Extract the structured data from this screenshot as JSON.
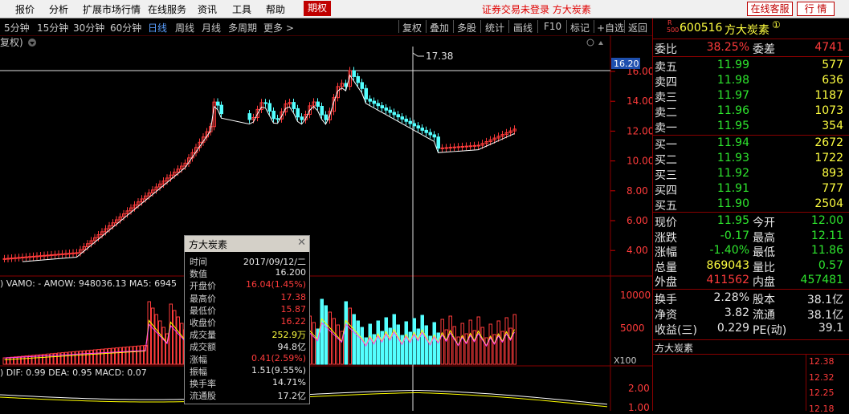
{
  "menu": {
    "items": [
      "报价",
      "分析",
      "扩展市场行情",
      "在线服务",
      "资讯",
      "工具",
      "帮助"
    ],
    "option_tab": "期权",
    "notice": "证券交易未登录  方大炭素",
    "online_service": "在线客服",
    "quote_button": "行 情"
  },
  "toolbar": {
    "periods": [
      "5分钟",
      "15分钟",
      "30分钟",
      "60分钟",
      "日线",
      "周线",
      "月线",
      "多周期",
      "更多 >"
    ],
    "active_period": "日线",
    "buttons": [
      "复权",
      "叠加",
      "多股",
      "统计",
      "画线",
      "F10",
      "标记",
      "+自选",
      "返回"
    ]
  },
  "chart": {
    "adjust_label": "复权)",
    "peak_label": "17.38",
    "current_price_tag": "16.20",
    "price_axis": [
      "16.00",
      "14.00",
      "12.00",
      "10.00",
      "8.00",
      "6.00",
      "4.00"
    ],
    "volume_header": ") VAMO: -   AMOW: 948036.13  MA5: 6945",
    "volume_axis": [
      "10000",
      "5000"
    ],
    "volume_unit": "X100",
    "macd_header": ") DIF: 0.99  DEA: 0.95  MACD: 0.07",
    "macd_axis": [
      "2.00",
      "1.00"
    ]
  },
  "tooltip": {
    "title": "方大炭素",
    "rows": [
      {
        "k": "时间",
        "v": "2017/09/12/二",
        "c": "white"
      },
      {
        "k": "数值",
        "v": "16.200",
        "c": "white"
      },
      {
        "k": "开盘价",
        "v": "16.04(1.45%)",
        "c": "red"
      },
      {
        "k": "最高价",
        "v": "17.38",
        "c": "red"
      },
      {
        "k": "最低价",
        "v": "15.87",
        "c": "red"
      },
      {
        "k": "收盘价",
        "v": "16.22",
        "c": "red"
      },
      {
        "k": "成交量",
        "v": "252.9万",
        "c": "yellow"
      },
      {
        "k": "成交额",
        "v": "94.8亿",
        "c": "white"
      },
      {
        "k": "涨幅",
        "v": "0.41(2.59%)",
        "c": "red"
      },
      {
        "k": "振幅",
        "v": "1.51(9.55%)",
        "c": "white"
      },
      {
        "k": "换手率",
        "v": "14.71%",
        "c": "white"
      },
      {
        "k": "流通股",
        "v": "17.2亿",
        "c": "white"
      }
    ]
  },
  "quote": {
    "stock_code": "600516",
    "stock_name": "方大炭素",
    "r_badge": "R",
    "r_sub": "500",
    "circle_mark": "①",
    "weibi_label": "委比",
    "weibi": "38.25%",
    "weicha_label": "委差",
    "weicha": "4741",
    "asks": [
      {
        "label": "卖五",
        "price": "11.99",
        "vol": "577"
      },
      {
        "label": "卖四",
        "price": "11.98",
        "vol": "636"
      },
      {
        "label": "卖三",
        "price": "11.97",
        "vol": "1187"
      },
      {
        "label": "卖二",
        "price": "11.96",
        "vol": "1073"
      },
      {
        "label": "卖一",
        "price": "11.95",
        "vol": "354"
      }
    ],
    "bids": [
      {
        "label": "买一",
        "price": "11.94",
        "vol": "2672"
      },
      {
        "label": "买二",
        "price": "11.93",
        "vol": "1722"
      },
      {
        "label": "买三",
        "price": "11.92",
        "vol": "893"
      },
      {
        "label": "买四",
        "price": "11.91",
        "vol": "777"
      },
      {
        "label": "买五",
        "price": "11.90",
        "vol": "2504"
      }
    ],
    "stats": [
      {
        "l1": "现价",
        "v1": "11.95",
        "c1": "green",
        "l2": "今开",
        "v2": "12.00",
        "c2": "green"
      },
      {
        "l1": "涨跌",
        "v1": "-0.17",
        "c1": "green",
        "l2": "最高",
        "v2": "12.11",
        "c2": "green"
      },
      {
        "l1": "涨幅",
        "v1": "-1.40%",
        "c1": "green",
        "l2": "最低",
        "v2": "11.86",
        "c2": "green"
      },
      {
        "l1": "总量",
        "v1": "869043",
        "c1": "yellow",
        "l2": "量比",
        "v2": "0.57",
        "c2": "green"
      },
      {
        "l1": "外盘",
        "v1": "411562",
        "c1": "red",
        "l2": "内盘",
        "v2": "457481",
        "c2": "green"
      }
    ],
    "fin": [
      {
        "l1": "换手",
        "v1": "2.28%",
        "l2": "股本",
        "v2": "38.1亿"
      },
      {
        "l1": "净资",
        "v1": "3.82",
        "l2": "流通",
        "v2": "38.1亿"
      },
      {
        "l1": "收益(三)",
        "v1": "0.229",
        "l2": "PE(动)",
        "v2": "39.1"
      }
    ],
    "mini_title": "方大炭素",
    "mini_axis": [
      "12.38",
      "12.32",
      "12.25",
      "12.18"
    ]
  },
  "colors": {
    "up": "#ff3b3b",
    "down": "#54ffff",
    "ma_white": "#ffffff",
    "ma_yellow": "#ffff00",
    "ma_magenta": "#ff40ff"
  }
}
